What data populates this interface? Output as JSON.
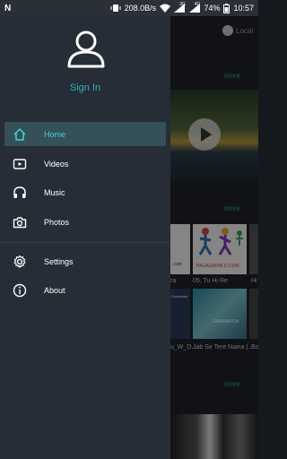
{
  "status_bar": {
    "notification_icon": "n-icon",
    "net_speed": "208.0B/s",
    "signal_1_label": "3G",
    "signal_2_label": "4G",
    "battery": "74%",
    "time": "10:57"
  },
  "drawer": {
    "avatar_icon": "user-icon",
    "sign_in_label": "Sign In",
    "items": [
      {
        "label": "Home",
        "icon": "home-icon",
        "active": true
      },
      {
        "label": "Videos",
        "icon": "video-icon",
        "active": false
      },
      {
        "label": "Music",
        "icon": "headphones-icon",
        "active": false
      },
      {
        "label": "Photos",
        "icon": "camera-icon",
        "active": false
      }
    ],
    "secondary_items": [
      {
        "label": "Settings",
        "icon": "settings-icon"
      },
      {
        "label": "About",
        "icon": "info-icon"
      }
    ]
  },
  "background_app": {
    "local_label": "Local",
    "more_labels": [
      "more",
      "more",
      "more"
    ],
    "captions_row1": [
      "ra",
      "05. Tu Hi Re",
      "Hi"
    ],
    "captions_row2": [
      "u_W_D...",
      "Jab Se Tere Naina (...",
      "Bo"
    ],
    "thumb_texts": [
      "Download",
      "PAGALWORLD.COM",
      ".com",
      "SANWARIYA"
    ]
  },
  "colors": {
    "accent": "#2fb0b2",
    "active_text": "#48d1d3",
    "drawer_bg": "#262d37",
    "active_bg": "#36505a"
  }
}
